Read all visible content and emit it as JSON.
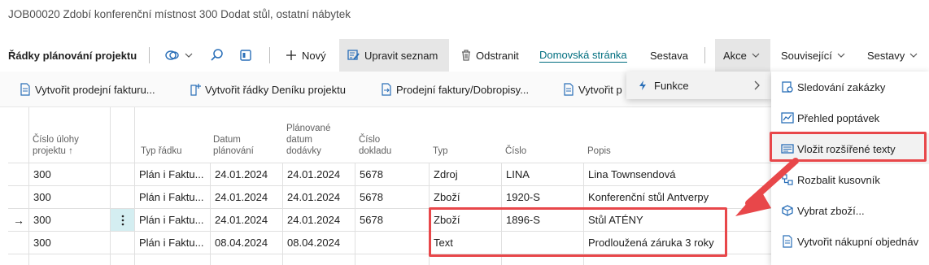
{
  "page": {
    "title": "JOB00020 Zdobí konferenční místnost 300 Dodat stůl, ostatní nábytek"
  },
  "toolbar": {
    "section_title": "Řádky plánování projektu",
    "new_label": "Nový",
    "edit_list_label": "Upravit seznam",
    "delete_label": "Odstranit",
    "home_label": "Domovská stránka",
    "report_label": "Sestava",
    "actions_label": "Akce",
    "related_label": "Související",
    "reports_label": "Sestavy"
  },
  "actionbar": {
    "items": [
      "Vytvořit prodejní fakturu...",
      "Vytvořit řádky Deníku projektu",
      "Prodejní faktury/Dobropisy...",
      "Vytvořit p"
    ]
  },
  "grid": {
    "headers": {
      "task_no": [
        "Číslo úlohy",
        "projektu ↑"
      ],
      "line_type": [
        "Typ řádku"
      ],
      "plan_date": [
        "Datum",
        "plánování"
      ],
      "delivery_date": [
        "Plánované",
        "datum",
        "dodávky"
      ],
      "doc_no": [
        "Číslo",
        "dokladu"
      ],
      "type": [
        "Typ"
      ],
      "no": [
        "Číslo"
      ],
      "desc": [
        "Popis"
      ]
    },
    "rows": [
      {
        "marker": "",
        "task_no": "300",
        "line_type": "Plán i Faktu...",
        "plan_date": "24.01.2024",
        "delivery_date": "24.01.2024",
        "doc_no": "5678",
        "type": "Zdroj",
        "no": "LINA",
        "desc": "Lina Townsendová"
      },
      {
        "marker": "",
        "task_no": "300",
        "line_type": "Plán i Faktu...",
        "plan_date": "24.01.2024",
        "delivery_date": "24.01.2024",
        "doc_no": "5678",
        "type": "Zboží",
        "no": "1920-S",
        "desc": "Konferenční stůl Antverpy"
      },
      {
        "marker": "→",
        "task_no": "300",
        "line_type": "Plán i Faktu...",
        "plan_date": "24.01.2024",
        "delivery_date": "24.01.2024",
        "doc_no": "5678",
        "type": "Zboží",
        "no": "1896-S",
        "desc": "Stůl ATÉNY"
      },
      {
        "marker": "",
        "task_no": "300",
        "line_type": "Plán i Faktu...",
        "plan_date": "08.04.2024",
        "delivery_date": "08.04.2024",
        "doc_no": "",
        "type": "Text",
        "no": "",
        "desc": "Prodloužená záruka 3 roky"
      }
    ]
  },
  "menu": {
    "functions_label": "Funkce",
    "items": [
      "Sledování zakázky",
      "Přehled poptávek",
      "Vložit rozšířené texty",
      "Rozbalit kusovník",
      "Vybrat zboží...",
      "Vytvořit nákupní objednáv"
    ]
  },
  "colors": {
    "accent": "#006e7f",
    "highlight": "#e8474a",
    "selected_bg": "#e6e6e6"
  }
}
